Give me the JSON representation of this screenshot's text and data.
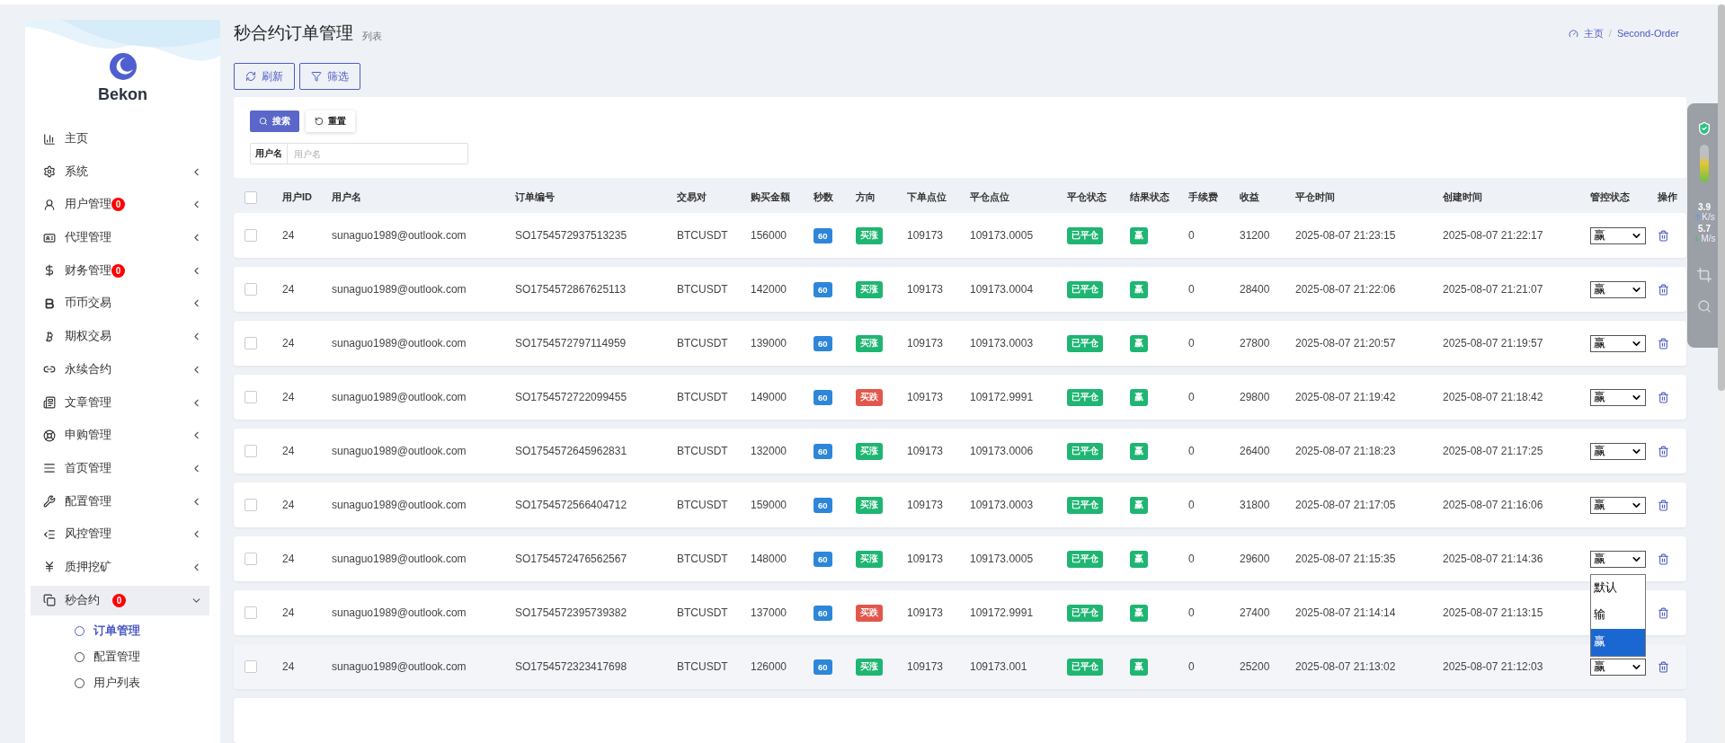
{
  "sidebar": {
    "brand": "Bekon",
    "items": [
      {
        "label": "主页",
        "expandable": false,
        "selected": false
      },
      {
        "label": "系统",
        "expandable": true,
        "expanded": false,
        "selected": false
      },
      {
        "label": "用户管理",
        "badge": "0",
        "expandable": true,
        "expanded": false,
        "selected": false
      },
      {
        "label": "代理管理",
        "expandable": true,
        "expanded": false,
        "selected": false
      },
      {
        "label": "财务管理",
        "badge": "0",
        "expandable": true,
        "expanded": false,
        "selected": false
      },
      {
        "label": "币币交易",
        "expandable": true,
        "expanded": false,
        "selected": false
      },
      {
        "label": "期权交易",
        "expandable": true,
        "expanded": false,
        "selected": false
      },
      {
        "label": "永续合约",
        "expandable": true,
        "expanded": false,
        "selected": false
      },
      {
        "label": "文章管理",
        "expandable": true,
        "expanded": false,
        "selected": false
      },
      {
        "label": "申购管理",
        "expandable": true,
        "expanded": false,
        "selected": false
      },
      {
        "label": "首页管理",
        "expandable": true,
        "expanded": false,
        "selected": false
      },
      {
        "label": "配置管理",
        "expandable": true,
        "expanded": false,
        "selected": false
      },
      {
        "label": "风控管理",
        "expandable": true,
        "expanded": false,
        "selected": false
      },
      {
        "label": "质押挖矿",
        "expandable": true,
        "expanded": false,
        "selected": false
      },
      {
        "label": "秒合约",
        "badge": "0",
        "expandable": true,
        "expanded": true,
        "selected": true,
        "children": [
          {
            "label": "订单管理",
            "selected": true
          },
          {
            "label": "配置管理",
            "selected": false
          },
          {
            "label": "用户列表",
            "selected": false
          }
        ]
      }
    ]
  },
  "header": {
    "title": "秒合约订单管理",
    "subtitle": "列表",
    "breadcrumb": [
      {
        "label": "主页"
      },
      {
        "separator": "/",
        "label": "Second-Order"
      }
    ]
  },
  "toolbar": [
    "刷新",
    "筛选"
  ],
  "search": {
    "buttons": [
      "搜索",
      "重置"
    ],
    "field": {
      "label": "用户名",
      "placeholder": "用户名"
    }
  },
  "table": {
    "select_all_checked": false,
    "columns": [
      "用户ID",
      "用户名",
      "订单编号",
      "交易对",
      "购买金额",
      "秒数",
      "方向",
      "下单点位",
      "平仓点位",
      "平仓状态",
      "结果状态",
      "手续费",
      "收益",
      "平仓时间",
      "创建时间",
      "管控状态",
      "操作"
    ],
    "rows": [
      {
        "checked": false,
        "highlighted": false,
        "user_id": "24",
        "username": "sunaguo1989@outlook.com",
        "order_no": "SO1754572937513235",
        "pair": "BTCUSDT",
        "amount": "156000",
        "seconds": "60",
        "direction": {
          "kind": "up",
          "label": "买涨"
        },
        "open_price": "109173",
        "close_price": "109173.0005",
        "close_status": "已平仓",
        "result": "赢",
        "fee": "0",
        "profit": "31200",
        "close_time": "2025-08-07 21:23:15",
        "create_time": "2025-08-07 21:22:17",
        "control": {
          "value": "赢"
        }
      },
      {
        "checked": false,
        "highlighted": false,
        "user_id": "24",
        "username": "sunaguo1989@outlook.com",
        "order_no": "SO1754572867625113",
        "pair": "BTCUSDT",
        "amount": "142000",
        "seconds": "60",
        "direction": {
          "kind": "up",
          "label": "买涨"
        },
        "open_price": "109173",
        "close_price": "109173.0004",
        "close_status": "已平仓",
        "result": "赢",
        "fee": "0",
        "profit": "28400",
        "close_time": "2025-08-07 21:22:06",
        "create_time": "2025-08-07 21:21:07",
        "control": {
          "value": "赢"
        }
      },
      {
        "checked": false,
        "highlighted": false,
        "user_id": "24",
        "username": "sunaguo1989@outlook.com",
        "order_no": "SO1754572797114959",
        "pair": "BTCUSDT",
        "amount": "139000",
        "seconds": "60",
        "direction": {
          "kind": "up",
          "label": "买涨"
        },
        "open_price": "109173",
        "close_price": "109173.0003",
        "close_status": "已平仓",
        "result": "赢",
        "fee": "0",
        "profit": "27800",
        "close_time": "2025-08-07 21:20:57",
        "create_time": "2025-08-07 21:19:57",
        "control": {
          "value": "赢"
        }
      },
      {
        "checked": false,
        "highlighted": false,
        "user_id": "24",
        "username": "sunaguo1989@outlook.com",
        "order_no": "SO1754572722099455",
        "pair": "BTCUSDT",
        "amount": "149000",
        "seconds": "60",
        "direction": {
          "kind": "down",
          "label": "买跌"
        },
        "open_price": "109173",
        "close_price": "109172.9991",
        "close_status": "已平仓",
        "result": "赢",
        "fee": "0",
        "profit": "29800",
        "close_time": "2025-08-07 21:19:42",
        "create_time": "2025-08-07 21:18:42",
        "control": {
          "value": "赢"
        }
      },
      {
        "checked": false,
        "highlighted": false,
        "user_id": "24",
        "username": "sunaguo1989@outlook.com",
        "order_no": "SO1754572645962831",
        "pair": "BTCUSDT",
        "amount": "132000",
        "seconds": "60",
        "direction": {
          "kind": "up",
          "label": "买涨"
        },
        "open_price": "109173",
        "close_price": "109173.0006",
        "close_status": "已平仓",
        "result": "赢",
        "fee": "0",
        "profit": "26400",
        "close_time": "2025-08-07 21:18:23",
        "create_time": "2025-08-07 21:17:25",
        "control": {
          "value": "赢"
        }
      },
      {
        "checked": false,
        "highlighted": false,
        "user_id": "24",
        "username": "sunaguo1989@outlook.com",
        "order_no": "SO1754572566404712",
        "pair": "BTCUSDT",
        "amount": "159000",
        "seconds": "60",
        "direction": {
          "kind": "up",
          "label": "买涨"
        },
        "open_price": "109173",
        "close_price": "109173.0003",
        "close_status": "已平仓",
        "result": "赢",
        "fee": "0",
        "profit": "31800",
        "close_time": "2025-08-07 21:17:05",
        "create_time": "2025-08-07 21:16:06",
        "control": {
          "value": "赢"
        }
      },
      {
        "checked": false,
        "highlighted": false,
        "user_id": "24",
        "username": "sunaguo1989@outlook.com",
        "order_no": "SO1754572476562567",
        "pair": "BTCUSDT",
        "amount": "148000",
        "seconds": "60",
        "direction": {
          "kind": "up",
          "label": "买涨"
        },
        "open_price": "109173",
        "close_price": "109173.0005",
        "close_status": "已平仓",
        "result": "赢",
        "fee": "0",
        "profit": "29600",
        "close_time": "2025-08-07 21:15:35",
        "create_time": "2025-08-07 21:14:36",
        "control": {
          "value": "赢",
          "options": [
            {
              "label": "默认",
              "selected": false
            },
            {
              "label": "输",
              "selected": false
            },
            {
              "label": "赢",
              "selected": true
            }
          ]
        }
      },
      {
        "checked": false,
        "highlighted": false,
        "user_id": "24",
        "username": "sunaguo1989@outlook.com",
        "order_no": "SO1754572395739382",
        "pair": "BTCUSDT",
        "amount": "137000",
        "seconds": "60",
        "direction": {
          "kind": "down",
          "label": "买跌"
        },
        "open_price": "109173",
        "close_price": "109172.9991",
        "close_status": "已平仓",
        "result": "赢",
        "fee": "0",
        "profit": "27400",
        "close_time": "2025-08-07 21:14:14",
        "create_time": "2025-08-07 21:13:15"
      },
      {
        "checked": false,
        "highlighted": true,
        "user_id": "24",
        "username": "sunaguo1989@outlook.com",
        "order_no": "SO1754572323417698",
        "pair": "BTCUSDT",
        "amount": "126000",
        "seconds": "60",
        "direction": {
          "kind": "up",
          "label": "买涨"
        },
        "open_price": "109173",
        "close_price": "109173.001",
        "close_status": "已平仓",
        "result": "赢",
        "fee": "0",
        "profit": "25200",
        "close_time": "2025-08-07 21:13:02",
        "create_time": "2025-08-07 21:12:03",
        "control": {
          "value": "赢"
        }
      }
    ]
  },
  "speed_widget": {
    "upload": {
      "value": "3.9",
      "unit": "K/s"
    },
    "download": {
      "value": "5.7",
      "unit": "M/s"
    }
  }
}
